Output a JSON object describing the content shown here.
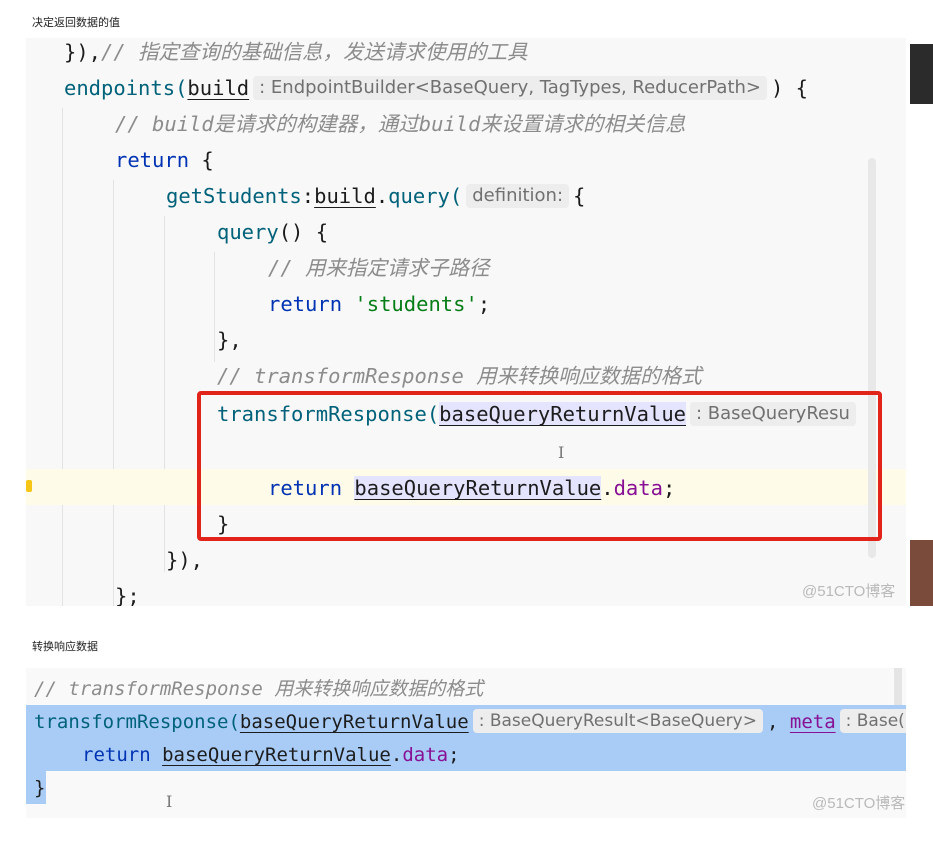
{
  "captions": {
    "first": "决定返回数据的值",
    "second": "转换响应数据"
  },
  "shot1": {
    "line1_a": "}),",
    "line1_comment": "// 指定查询的基础信息，发送请求使用的工具",
    "line2_fn": "endpoints(",
    "line2_param": "build",
    "line2_hint": ": EndpointBuilder<BaseQuery, TagTypes, ReducerPath>",
    "line2_end": ") {",
    "line3_comment": "// build是请求的构建器，通过build来设置请求的相关信息",
    "line4_kw": "return",
    "line4_end": " {",
    "line5_fn": "getStudents",
    "line5_colon": ":",
    "line5_build": "build",
    "line5_dot": ".",
    "line5_query": "query(",
    "line5_hint": "definition:",
    "line5_end": "{",
    "line6_fn": "query",
    "line6_end": "() {",
    "line7_comment": "// 用来指定请求子路径",
    "line8_kw": "return",
    "line8_str": "'students'",
    "line8_end": ";",
    "line9": "},",
    "line10_comment": "// transformResponse 用来转换响应数据的格式",
    "line11_fn": "transformResponse(",
    "line11_param": "baseQueryReturnValue",
    "line11_hint": ": BaseQueryResu",
    "line13_kw": "return",
    "line13_param": "baseQueryReturnValue",
    "line13_dot": ".",
    "line13_prop": "data",
    "line13_end": ";",
    "line14": "}",
    "line15": "}),",
    "line16": "};",
    "watermark": "@51CTO博客"
  },
  "shot2": {
    "comment": "// transformResponse 用来转换响应数据的格式",
    "line2_fn": "transformResponse(",
    "line2_param": "baseQueryReturnValue",
    "line2_hint": ": BaseQueryResult<BaseQuery>",
    "line2_comma": ",",
    "line2_meta": "meta",
    "line2_hint2": ": Base(",
    "line3_kw": "return",
    "line3_param": "baseQueryReturnValue",
    "line3_dot": ".",
    "line3_prop": "data",
    "line3_end": ";",
    "line4": "}",
    "watermark": "@51CTO博客"
  },
  "colors": {
    "keyword": "#0033b3",
    "function": "#00627a",
    "string": "#067d17",
    "property": "#871094",
    "comment": "#8c8c8c",
    "highlight_box": "#e2231a",
    "selection": "#a9ccf6"
  }
}
